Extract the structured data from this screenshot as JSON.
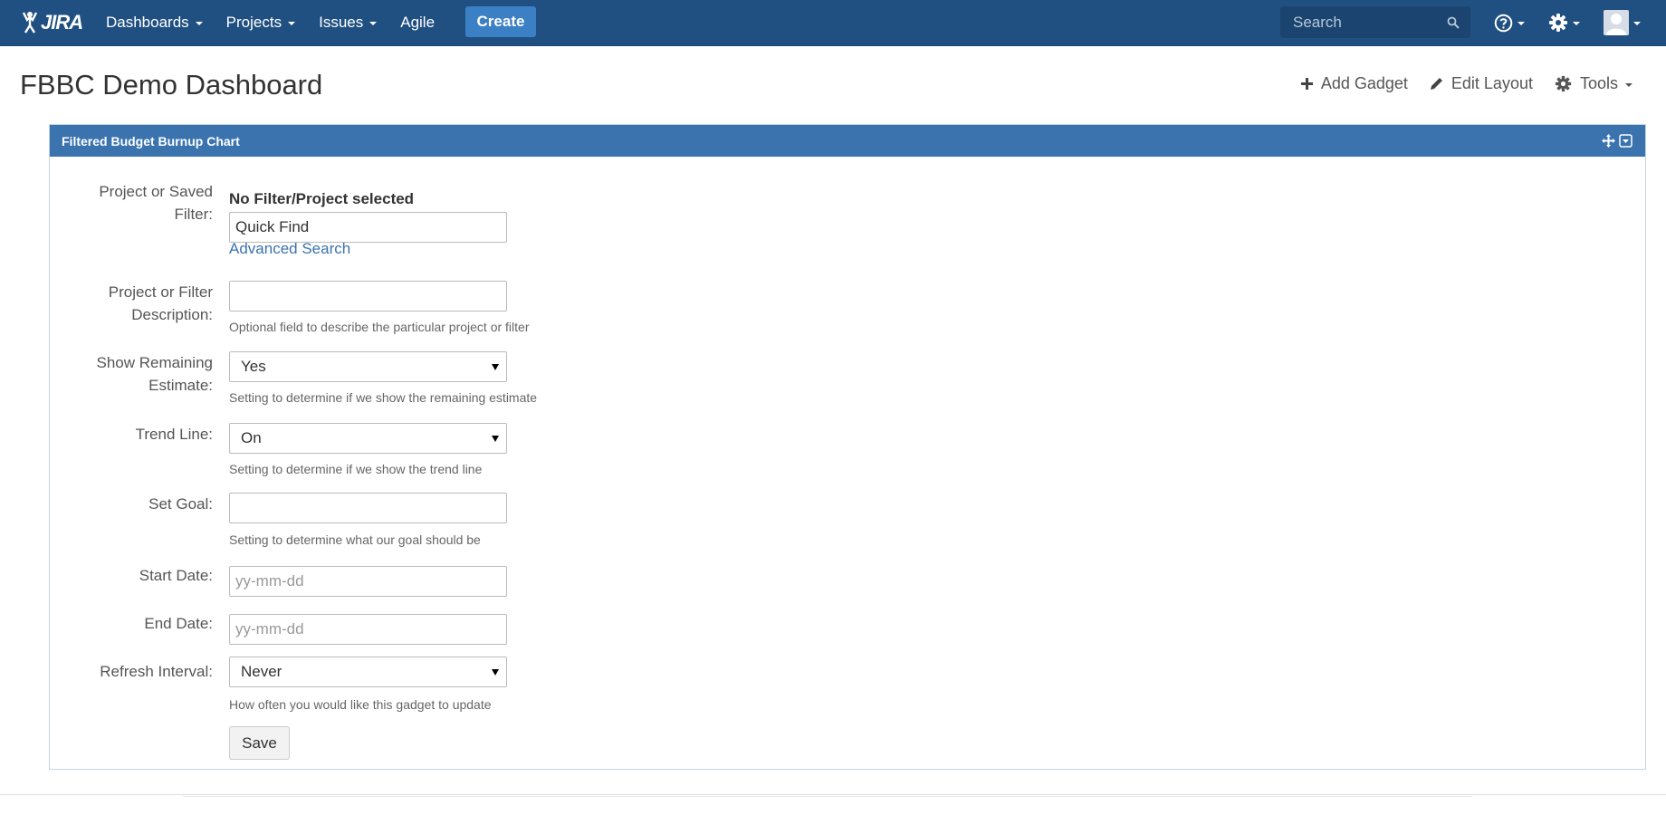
{
  "topbar": {
    "logo_text": "JIRA",
    "nav": [
      {
        "label": "Dashboards",
        "has_caret": true
      },
      {
        "label": "Projects",
        "has_caret": true
      },
      {
        "label": "Issues",
        "has_caret": true
      },
      {
        "label": "Agile",
        "has_caret": false
      }
    ],
    "create_label": "Create",
    "search_placeholder": "Search",
    "icons": [
      "help-icon",
      "gear-icon",
      "user-avatar-icon"
    ]
  },
  "page": {
    "title": "FBBC Demo Dashboard",
    "tools": {
      "add_gadget": "Add Gadget",
      "edit_layout": "Edit Layout",
      "tools": "Tools"
    }
  },
  "gadget": {
    "title": "Filtered Budget Burnup Chart",
    "fields": {
      "project_filter": {
        "label_line1": "Project or Saved",
        "label_line2": "Filter:",
        "selected": "No Filter/Project selected",
        "quick_find_value": "Quick Find",
        "advanced_search": "Advanced Search"
      },
      "description": {
        "label_line1": "Project or Filter",
        "label_line2": "Description:",
        "value": "",
        "help": "Optional field to describe the particular project or filter"
      },
      "remaining_estimate": {
        "label_line1": "Show Remaining",
        "label_line2": "Estimate:",
        "value": "Yes",
        "help": "Setting to determine if we show the remaining estimate"
      },
      "trend_line": {
        "label": "Trend Line:",
        "value": "On",
        "help": "Setting to determine if we show the trend line"
      },
      "set_goal": {
        "label": "Set Goal:",
        "value": "",
        "help": "Setting to determine what our goal should be"
      },
      "start_date": {
        "label": "Start Date:",
        "placeholder": "yy-mm-dd"
      },
      "end_date": {
        "label": "End Date:",
        "placeholder": "yy-mm-dd"
      },
      "refresh_interval": {
        "label": "Refresh Interval:",
        "value": "Never",
        "help": "How often you would like this gadget to update"
      }
    },
    "save_label": "Save"
  },
  "colors": {
    "topbar_bg": "#205081",
    "create_bg": "#3b7fc4",
    "gadget_header_bg": "#3b73af",
    "link": "#3b73af"
  }
}
